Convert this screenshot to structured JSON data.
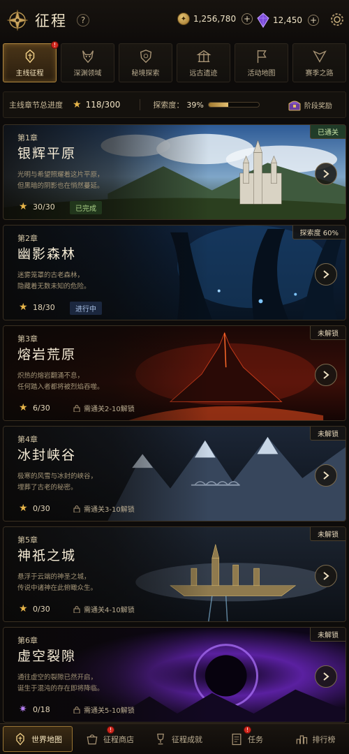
{
  "header": {
    "title": "征程",
    "help": "?",
    "gold": "1,256,780",
    "gems": "12,450",
    "plus": "+"
  },
  "tabs": [
    {
      "label": "主线征程",
      "icon": "helm-icon",
      "active": true,
      "badge": "!"
    },
    {
      "label": "深渊领域",
      "icon": "demon-icon",
      "active": false
    },
    {
      "label": "秘境探索",
      "icon": "shield-icon",
      "active": false
    },
    {
      "label": "远古遗迹",
      "icon": "ruin-icon",
      "active": false
    },
    {
      "label": "活动地图",
      "icon": "banner-icon",
      "active": false
    },
    {
      "label": "赛季之路",
      "icon": "crest-icon",
      "active": false
    }
  ],
  "progress": {
    "label": "主线章节总进度",
    "stars": "118/300",
    "explore_label": "探索度：",
    "explore_pct": "39%",
    "explore_value": 0.39,
    "reward_label": "阶段奖励"
  },
  "chapters": [
    {
      "no": "第1章",
      "name": "银辉平原",
      "desc": [
        "光明与希望照耀着这片平原，",
        "但黑暗的阴影也在悄然蔓延。"
      ],
      "count": "30/30",
      "status": "已完成",
      "status_type": "done",
      "badge": "已通关",
      "badge_type": "cleared",
      "theme": "blue-sky"
    },
    {
      "no": "第2章",
      "name": "幽影森林",
      "desc": [
        "迷雾笼罩的古老森林，",
        "隐藏着无数未知的危险。"
      ],
      "count": "18/30",
      "status": "进行中",
      "status_type": "progress",
      "badge": "探索度 60%",
      "badge_type": "normal",
      "theme": "dark-forest"
    },
    {
      "no": "第3章",
      "name": "熔岩荒原",
      "desc": [
        "炽热的熔岩翻涌不息，",
        "任何踏入者都将被烈焰吞噬。"
      ],
      "count": "6/30",
      "lock": "需通关2-10解锁",
      "badge": "未解锁",
      "badge_type": "normal",
      "theme": "lava"
    },
    {
      "no": "第4章",
      "name": "冰封峡谷",
      "desc": [
        "极寒的风雪与冰封的峡谷，",
        "埋葬了古老的秘密。"
      ],
      "count": "0/30",
      "lock": "需通关3-10解锁",
      "badge": "未解锁",
      "badge_type": "normal",
      "theme": "ice"
    },
    {
      "no": "第5章",
      "name": "神祇之城",
      "desc": [
        "悬浮于云端的神圣之城，",
        "传说中诸神在此俯瞰众生。"
      ],
      "count": "0/30",
      "lock": "需通关4-10解锁",
      "badge": "未解锁",
      "badge_type": "normal",
      "theme": "sky-city"
    },
    {
      "no": "第6章",
      "name": "虚空裂隙",
      "desc": [
        "通往虚空的裂隙已然开启，",
        "诞生于混沌的存在即将降临。"
      ],
      "count": "0/18",
      "lock": "需通关5-10解锁",
      "badge": "未解锁",
      "badge_type": "normal",
      "theme": "void"
    }
  ],
  "bottom_nav": [
    {
      "label": "世界地图",
      "icon": "helm-icon",
      "active": true
    },
    {
      "label": "征程商店",
      "icon": "shop-icon",
      "active": false,
      "badge": "!"
    },
    {
      "label": "征程成就",
      "icon": "trophy-icon",
      "active": false
    },
    {
      "label": "任务",
      "icon": "scroll-icon",
      "active": false,
      "badge": "!"
    },
    {
      "label": "排行榜",
      "icon": "rank-icon",
      "active": false
    }
  ]
}
